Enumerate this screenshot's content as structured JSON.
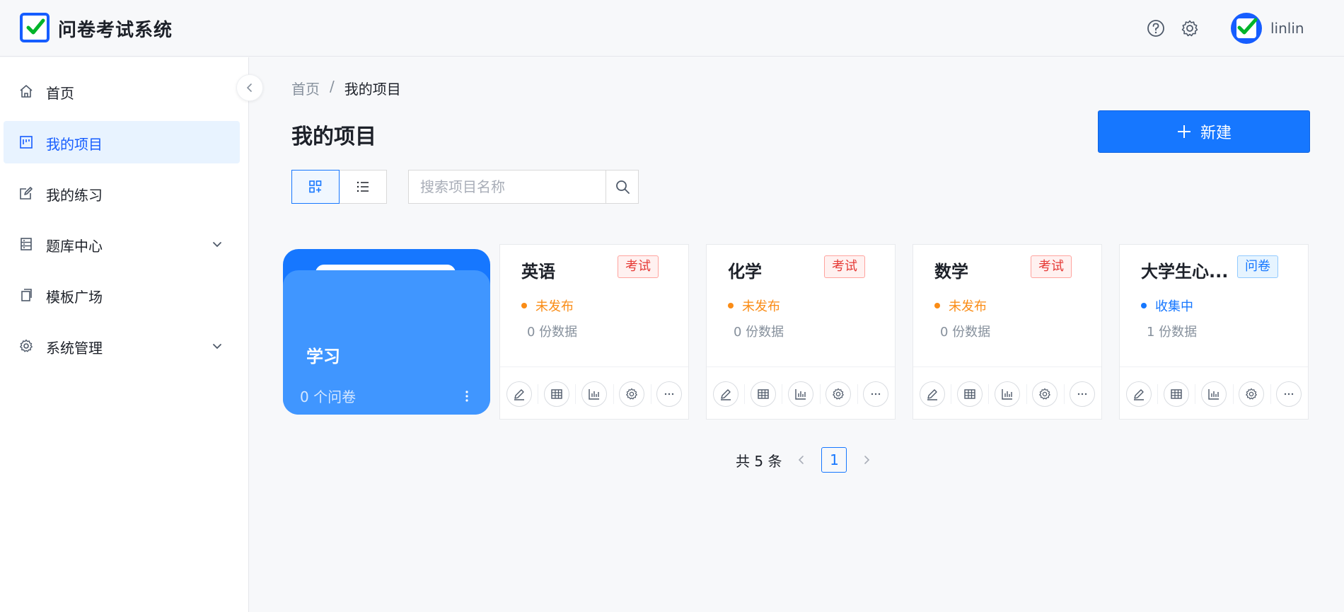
{
  "app": {
    "title": "问卷考试系统",
    "username": "linlin"
  },
  "header": {
    "help_icon": "question-circle-icon",
    "settings_icon": "gear-icon"
  },
  "sidebar": {
    "items": [
      {
        "label": "首页",
        "icon": "home-icon"
      },
      {
        "label": "我的项目",
        "icon": "project-icon",
        "active": true
      },
      {
        "label": "我的练习",
        "icon": "edit-icon"
      },
      {
        "label": "题库中心",
        "icon": "database-icon",
        "expandable": true
      },
      {
        "label": "模板广场",
        "icon": "copy-icon"
      },
      {
        "label": "系统管理",
        "icon": "gear-icon",
        "expandable": true
      }
    ]
  },
  "breadcrumb": {
    "home": "首页",
    "separator": "/",
    "current": "我的项目"
  },
  "page": {
    "title": "我的项目",
    "new_label": "新建"
  },
  "search": {
    "placeholder": "搜索项目名称",
    "value": ""
  },
  "folder": {
    "name": "学习",
    "count": "0 个问卷"
  },
  "projects": [
    {
      "title": "英语",
      "tag": "考试",
      "status": "未发布",
      "data": "0 份数据"
    },
    {
      "title": "化学",
      "tag": "考试",
      "status": "未发布",
      "data": "0 份数据"
    },
    {
      "title": "数学",
      "tag": "考试",
      "status": "未发布",
      "data": "0 份数据"
    },
    {
      "title": "大学生心...",
      "tag": "问卷",
      "status": "收集中",
      "data": "1 份数据"
    }
  ],
  "pagination": {
    "total": "共 5 条",
    "current_page": "1"
  },
  "colors": {
    "primary": "#1677ff",
    "sidebar_active_bg": "#e8f3ff",
    "exam_tag": "#e53935",
    "unpublished": "#fa8c16",
    "collecting": "#1677ff"
  }
}
